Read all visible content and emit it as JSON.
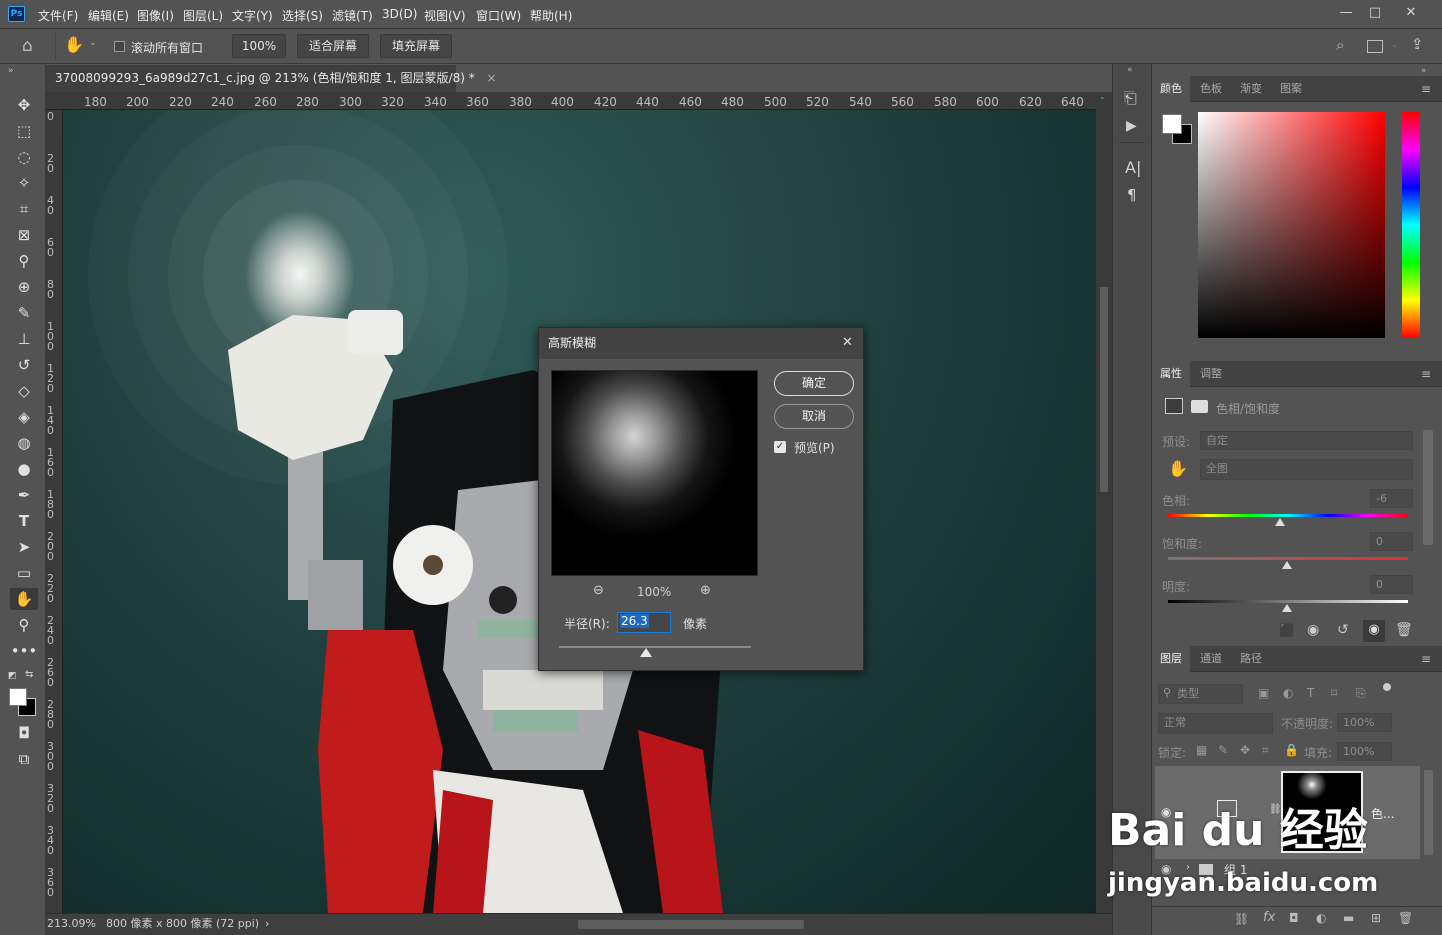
{
  "app": {
    "logo": "Ps"
  },
  "menu": [
    "文件(F)",
    "编辑(E)",
    "图像(I)",
    "图层(L)",
    "文字(Y)",
    "选择(S)",
    "滤镜(T)",
    "3D(D)",
    "视图(V)",
    "窗口(W)",
    "帮助(H)"
  ],
  "window_controls": {
    "minimize": "—",
    "maximize": "□",
    "close": "✕"
  },
  "options": {
    "scroll_all_label": "滚动所有窗口",
    "zoom_value": "100%",
    "fit_screen": "适合屏幕",
    "fill_screen": "填充屏幕"
  },
  "document": {
    "tab_title": "37008099293_6a989d27c1_c.jpg @ 213% (色相/饱和度 1, 图层蒙版/8) *",
    "tab_close": "×"
  },
  "rulers": {
    "top": [
      "180",
      "200",
      "220",
      "240",
      "260",
      "280",
      "300",
      "320",
      "340",
      "360",
      "380",
      "400",
      "420",
      "440",
      "460",
      "480",
      "500",
      "520",
      "540",
      "560",
      "580",
      "600",
      "620",
      "640"
    ],
    "left": [
      "0",
      "20",
      "40",
      "60",
      "80",
      "100",
      "120",
      "140",
      "160",
      "180",
      "200",
      "220",
      "240",
      "260",
      "280",
      "300",
      "320",
      "340",
      "360"
    ]
  },
  "status": {
    "zoom": "213.09%",
    "info": "800 像素 x 800 像素 (72 ppi)",
    "arrow": "›"
  },
  "dialog": {
    "title": "高斯模糊",
    "ok": "确定",
    "cancel": "取消",
    "preview": "预览(P)",
    "zoom": "100%",
    "radius_label": "半径(R):",
    "radius_value": "26.3",
    "unit": "像素",
    "close": "✕"
  },
  "panels": {
    "color_tabs": [
      "颜色",
      "色板",
      "渐变",
      "图案"
    ],
    "props_tabs": [
      "属性",
      "调整"
    ],
    "props_title": "色相/饱和度",
    "preset_label": "预设:",
    "preset_value": "自定",
    "range_value": "全图",
    "hue_label": "色相:",
    "hue_value": "-6",
    "sat_label": "饱和度:",
    "sat_value": "0",
    "light_label": "明度:",
    "light_value": "0",
    "layers_tabs": [
      "图层",
      "通道",
      "路径"
    ],
    "kind_label": "类型",
    "blend_mode": "正常",
    "opacity_label": "不透明度:",
    "opacity_value": "100%",
    "lock_label": "锁定:",
    "fill_label": "填充:",
    "fill_value": "100%",
    "layer1_name": "色...",
    "group_name": "组 1"
  },
  "watermark": {
    "line1": "Bai du 经验",
    "line2": "jingyan.baidu.com"
  },
  "colors": {
    "accent": "#31a8ff",
    "bg": "#535353"
  }
}
